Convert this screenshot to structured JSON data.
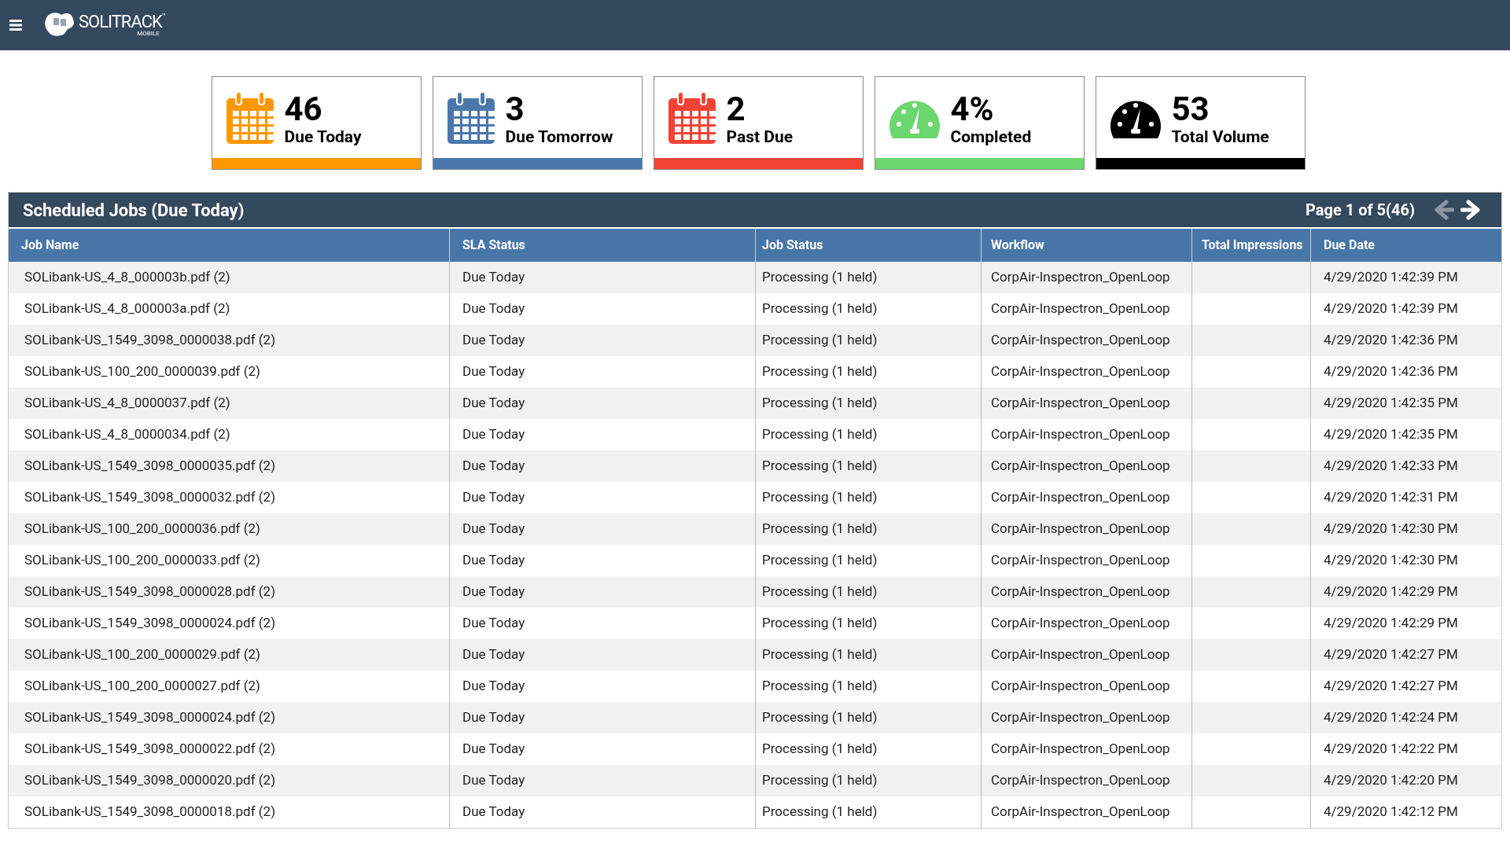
{
  "header": {
    "logo_text": "SOLITRACK",
    "logo_tm": "™",
    "logo_sub": "MOBILE"
  },
  "cards": [
    {
      "kind": "calendar",
      "color": "#ff9800",
      "value": "46",
      "label": "Due Today"
    },
    {
      "kind": "calendar",
      "color": "#4a78ac",
      "value": "3",
      "label": "Due Tomorrow"
    },
    {
      "kind": "calendar",
      "color": "#f44336",
      "value": "2",
      "label": "Past Due"
    },
    {
      "kind": "gauge",
      "color": "#6cd66f",
      "value": "4%",
      "label": "Completed"
    },
    {
      "kind": "gauge",
      "color": "#000000",
      "value": "53",
      "label": "Total Volume"
    }
  ],
  "panel": {
    "title": "Scheduled Jobs (Due Today)",
    "page_info": "Page 1 of 5(46)",
    "prev": {
      "disabled": true
    },
    "next": {
      "disabled": false
    }
  },
  "table": {
    "columns": [
      "Job Name",
      "SLA Status",
      "Job Status",
      "Workflow",
      "Total Impressions",
      "Due Date"
    ],
    "rows": [
      {
        "job_name": "SOLibank-US_4_8_000003b.pdf (2)",
        "sla_status": "Due Today",
        "job_status": "Processing (1 held)",
        "workflow": "CorpAir-Inspectron_OpenLoop",
        "due_date": "4/29/2020 1:42:39 PM"
      },
      {
        "job_name": "SOLibank-US_4_8_000003a.pdf (2)",
        "sla_status": "Due Today",
        "job_status": "Processing (1 held)",
        "workflow": "CorpAir-Inspectron_OpenLoop",
        "due_date": "4/29/2020 1:42:39 PM"
      },
      {
        "job_name": "SOLibank-US_1549_3098_0000038.pdf (2)",
        "sla_status": "Due Today",
        "job_status": "Processing (1 held)",
        "workflow": "CorpAir-Inspectron_OpenLoop",
        "due_date": "4/29/2020 1:42:36 PM"
      },
      {
        "job_name": "SOLibank-US_100_200_0000039.pdf (2)",
        "sla_status": "Due Today",
        "job_status": "Processing (1 held)",
        "workflow": "CorpAir-Inspectron_OpenLoop",
        "due_date": "4/29/2020 1:42:36 PM"
      },
      {
        "job_name": "SOLibank-US_4_8_0000037.pdf (2)",
        "sla_status": "Due Today",
        "job_status": "Processing (1 held)",
        "workflow": "CorpAir-Inspectron_OpenLoop",
        "due_date": "4/29/2020 1:42:35 PM"
      },
      {
        "job_name": "SOLibank-US_4_8_0000034.pdf (2)",
        "sla_status": "Due Today",
        "job_status": "Processing (1 held)",
        "workflow": "CorpAir-Inspectron_OpenLoop",
        "due_date": "4/29/2020 1:42:35 PM"
      },
      {
        "job_name": "SOLibank-US_1549_3098_0000035.pdf (2)",
        "sla_status": "Due Today",
        "job_status": "Processing (1 held)",
        "workflow": "CorpAir-Inspectron_OpenLoop",
        "due_date": "4/29/2020 1:42:33 PM"
      },
      {
        "job_name": "SOLibank-US_1549_3098_0000032.pdf (2)",
        "sla_status": "Due Today",
        "job_status": "Processing (1 held)",
        "workflow": "CorpAir-Inspectron_OpenLoop",
        "due_date": "4/29/2020 1:42:31 PM"
      },
      {
        "job_name": "SOLibank-US_100_200_0000036.pdf (2)",
        "sla_status": "Due Today",
        "job_status": "Processing (1 held)",
        "workflow": "CorpAir-Inspectron_OpenLoop",
        "due_date": "4/29/2020 1:42:30 PM"
      },
      {
        "job_name": "SOLibank-US_100_200_0000033.pdf (2)",
        "sla_status": "Due Today",
        "job_status": "Processing (1 held)",
        "workflow": "CorpAir-Inspectron_OpenLoop",
        "due_date": "4/29/2020 1:42:30 PM"
      },
      {
        "job_name": "SOLibank-US_1549_3098_0000028.pdf (2)",
        "sla_status": "Due Today",
        "job_status": "Processing (1 held)",
        "workflow": "CorpAir-Inspectron_OpenLoop",
        "due_date": "4/29/2020 1:42:29 PM"
      },
      {
        "job_name": "SOLibank-US_1549_3098_0000024.pdf (2)",
        "sla_status": "Due Today",
        "job_status": "Processing (1 held)",
        "workflow": "CorpAir-Inspectron_OpenLoop",
        "due_date": "4/29/2020 1:42:29 PM"
      },
      {
        "job_name": "SOLibank-US_100_200_0000029.pdf (2)",
        "sla_status": "Due Today",
        "job_status": "Processing (1 held)",
        "workflow": "CorpAir-Inspectron_OpenLoop",
        "due_date": "4/29/2020 1:42:27 PM"
      },
      {
        "job_name": "SOLibank-US_100_200_0000027.pdf (2)",
        "sla_status": "Due Today",
        "job_status": "Processing (1 held)",
        "workflow": "CorpAir-Inspectron_OpenLoop",
        "due_date": "4/29/2020 1:42:27 PM"
      },
      {
        "job_name": "SOLibank-US_1549_3098_0000024.pdf (2)",
        "sla_status": "Due Today",
        "job_status": "Processing (1 held)",
        "workflow": "CorpAir-Inspectron_OpenLoop",
        "due_date": "4/29/2020 1:42:24 PM"
      },
      {
        "job_name": "SOLibank-US_1549_3098_0000022.pdf (2)",
        "sla_status": "Due Today",
        "job_status": "Processing (1 held)",
        "workflow": "CorpAir-Inspectron_OpenLoop",
        "due_date": "4/29/2020 1:42:22 PM"
      },
      {
        "job_name": "SOLibank-US_1549_3098_0000020.pdf (2)",
        "sla_status": "Due Today",
        "job_status": "Processing (1 held)",
        "workflow": "CorpAir-Inspectron_OpenLoop",
        "due_date": "4/29/2020 1:42:20 PM"
      },
      {
        "job_name": "SOLibank-US_1549_3098_0000018.pdf (2)",
        "sla_status": "Due Today",
        "job_status": "Processing (1 held)",
        "workflow": "CorpAir-Inspectron_OpenLoop",
        "due_date": "4/29/2020 1:42:12 PM"
      }
    ]
  }
}
